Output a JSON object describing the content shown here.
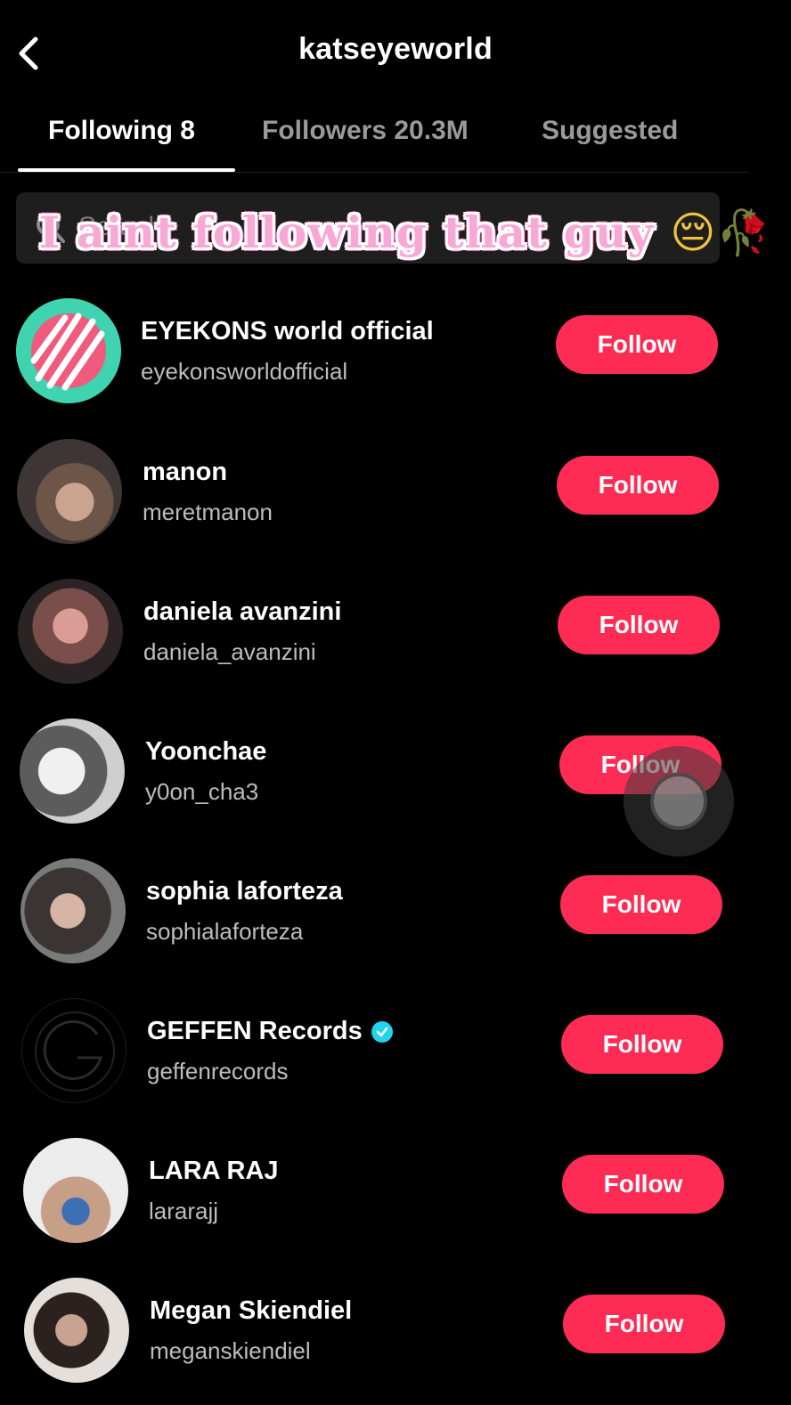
{
  "header": {
    "title": "katseyeworld",
    "back_icon": "chevron-left-icon"
  },
  "tabs": [
    {
      "label": "Following 8",
      "active": true
    },
    {
      "label": "Followers 20.3M",
      "active": false
    },
    {
      "label": "Suggested",
      "active": false
    }
  ],
  "search": {
    "placeholder": "Search",
    "icon": "search-icon"
  },
  "caption": {
    "text": "I aint following that guy",
    "emojis": "😔🥀"
  },
  "accounts": [
    {
      "name": "EYEKONS world official",
      "handle": "eyekonsworldofficial",
      "button": "Follow",
      "verified": false,
      "avatar_color": "#3fd3b0"
    },
    {
      "name": "manon",
      "handle": "meretmanon",
      "button": "Follow",
      "verified": false,
      "avatar_color": "#8a7466"
    },
    {
      "name": "daniela avanzini",
      "handle": "daniela_avanzini",
      "button": "Follow",
      "verified": false,
      "avatar_color": "#a4706e"
    },
    {
      "name": "Yoonchae",
      "handle": "y0on_cha3",
      "button": "Follow",
      "verified": false,
      "avatar_color": "#d8d8d8"
    },
    {
      "name": "sophia laforteza",
      "handle": "sophialaforteza",
      "button": "Follow",
      "verified": false,
      "avatar_color": "#6d6a68"
    },
    {
      "name": "GEFFEN Records",
      "handle": "geffenrecords",
      "button": "Follow",
      "verified": true,
      "avatar_color": "#000000"
    },
    {
      "name": "LARA RAJ",
      "handle": "lararajj",
      "button": "Follow",
      "verified": false,
      "avatar_color": "#c9b7a6"
    },
    {
      "name": "Megan Skiendiel",
      "handle": "meganskiendiel",
      "button": "Follow",
      "verified": false,
      "avatar_color": "#d9d2cc"
    }
  ],
  "colors": {
    "accent": "#fe2c55",
    "verified": "#20d5ec",
    "caption_fill": "#f7a8d4"
  }
}
